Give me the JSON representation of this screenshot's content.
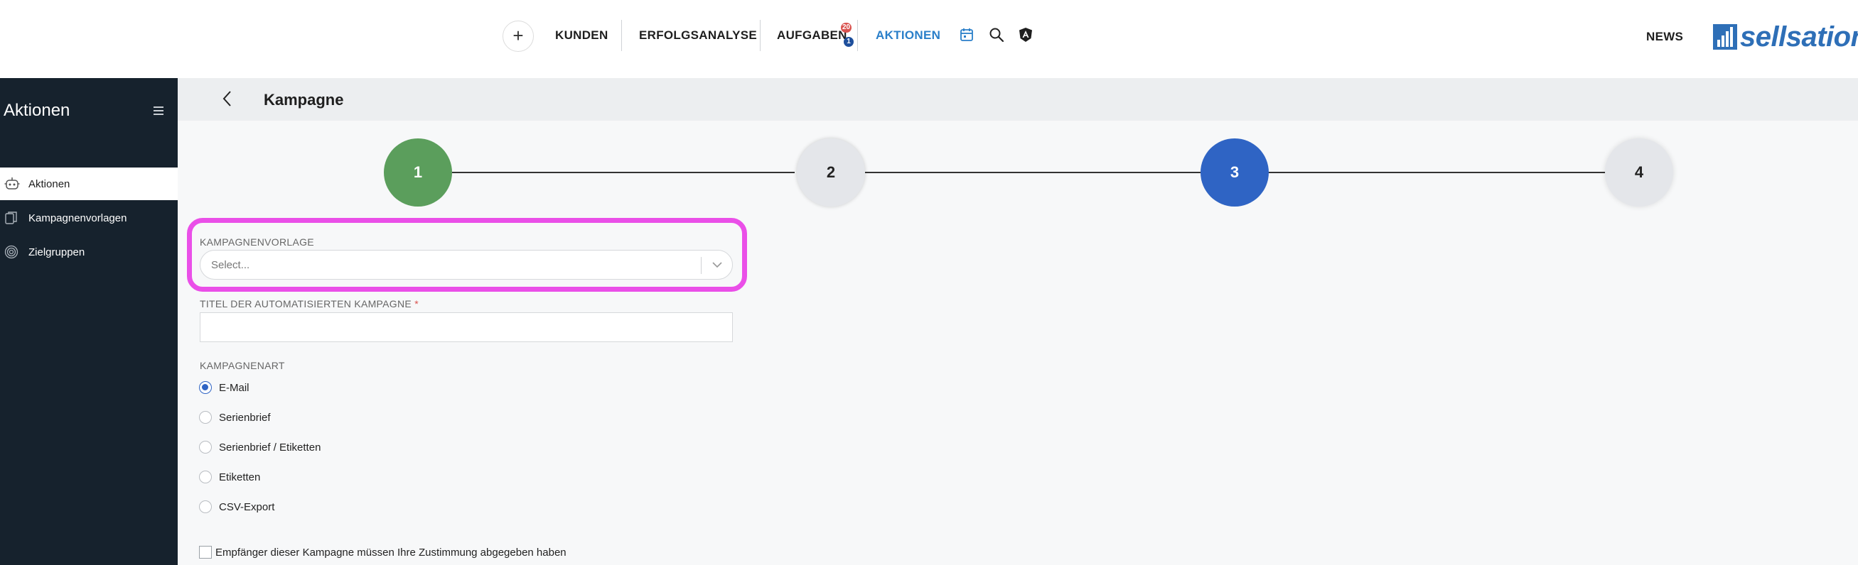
{
  "topnav": {
    "plus": "+",
    "items": [
      "KUNDEN",
      "ERFOLGSANALYSE",
      "AUFGABEN",
      "AKTIONEN"
    ],
    "badges": {
      "tasks_red": "20",
      "tasks_blue": "1"
    },
    "icons": [
      "calendar-icon",
      "search-icon",
      "angular-icon"
    ],
    "news": "NEWS",
    "logo": "sellsation"
  },
  "sidebar": {
    "title": "Aktionen",
    "items": [
      {
        "label": "Aktionen",
        "icon": "robot-icon",
        "active": true
      },
      {
        "label": "Kampagnenvorlagen",
        "icon": "copy-icon",
        "active": false
      },
      {
        "label": "Zielgruppen",
        "icon": "target-icon",
        "active": false
      }
    ]
  },
  "header": {
    "title": "Kampagne"
  },
  "stepper": {
    "steps": [
      "1",
      "2",
      "3",
      "4"
    ],
    "colors": {
      "done": "#5b9e5c",
      "current": "#2f64c4",
      "pending": "#e4e6ea"
    }
  },
  "form": {
    "template_label": "KAMPAGNENVORLAGE",
    "template_placeholder": "Select...",
    "title_label": "TITEL DER AUTOMATISIERTEN KAMPAGNE",
    "required_mark": "*",
    "title_value": "",
    "type_label": "KAMPAGNENART",
    "types": [
      {
        "label": "E-Mail",
        "checked": true
      },
      {
        "label": "Serienbrief",
        "checked": false
      },
      {
        "label": "Serienbrief / Etiketten",
        "checked": false
      },
      {
        "label": "Etiketten",
        "checked": false
      },
      {
        "label": "CSV-Export",
        "checked": false
      }
    ],
    "consent_label": "Empfänger dieser Kampagne müssen Ihre Zustimmung abgegeben haben"
  },
  "colors": {
    "accent": "#2a7fc9",
    "highlight": "#ea4fe8",
    "sidebar_bg": "#16222d"
  }
}
